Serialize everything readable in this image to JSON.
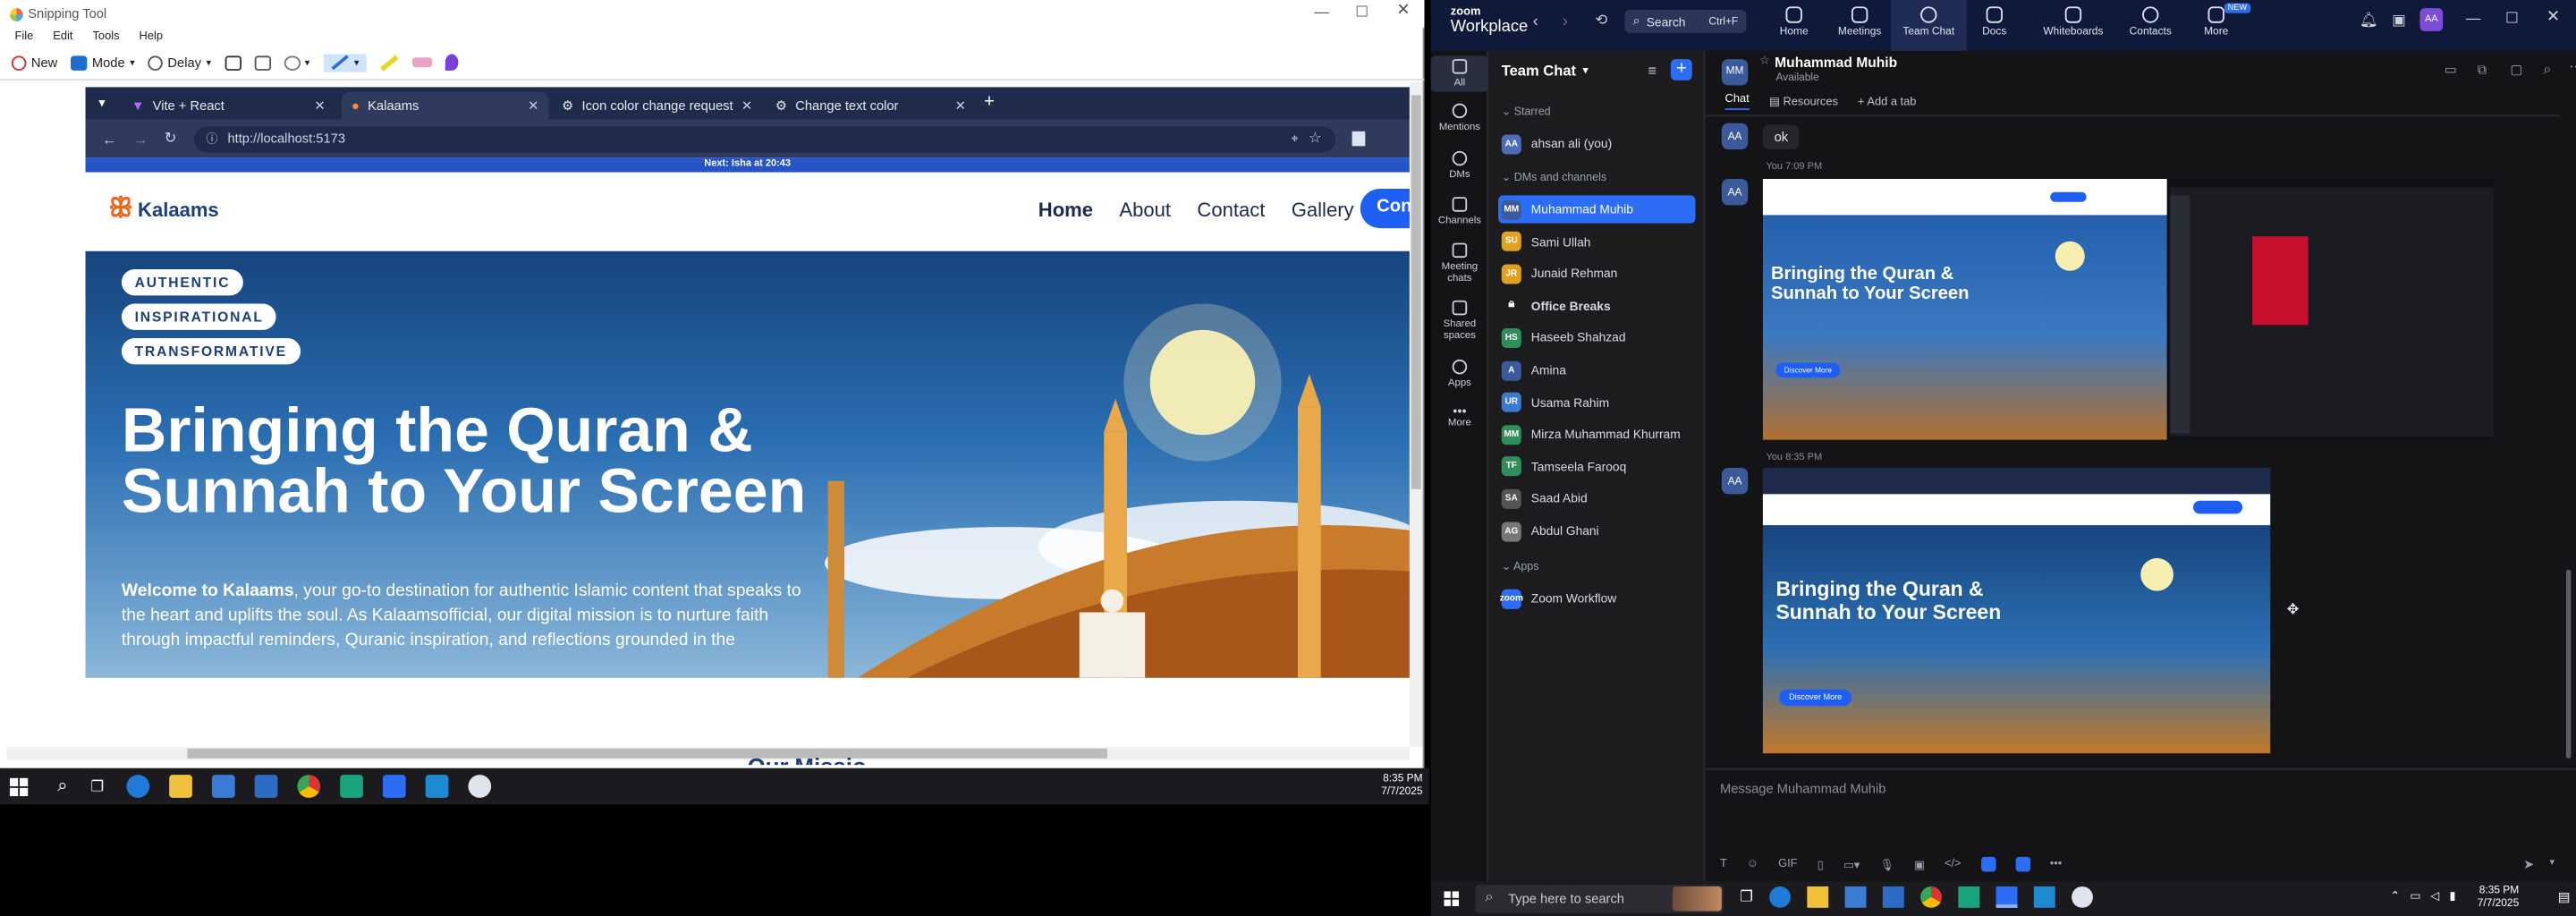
{
  "snip": {
    "title": "Snipping Tool",
    "menu": [
      "File",
      "Edit",
      "Tools",
      "Help"
    ],
    "new_label": "New",
    "mode_label": "Mode",
    "delay_label": "Delay"
  },
  "browser": {
    "tabs": [
      {
        "label": "Vite + React"
      },
      {
        "label": "Kalaams"
      },
      {
        "label": "Icon color change request"
      },
      {
        "label": "Change text color"
      }
    ],
    "url": "http://localhost:5173",
    "next_prayer": "Next: Isha at 20:43"
  },
  "site": {
    "brand": "Kalaams",
    "nav": [
      "Home",
      "About",
      "Contact",
      "Gallery"
    ],
    "cta": "Con",
    "badges": [
      "AUTHENTIC",
      "INSPIRATIONAL",
      "TRANSFORMATIVE"
    ],
    "headline": "Bringing the Quran & Sunnah to Your Screen",
    "para_a": "Welcome to Kalaams",
    "para_b": ", your go-to destination for authentic Islamic content that speaks to the heart and uplifts the soul. As Kalaamsofficial, our digital mission is to nurture faith through impactful reminders, Quranic inspiration, and reflections grounded in the",
    "partial": "Our Missio"
  },
  "left_taskbar": {
    "time": "8:35 PM",
    "date": "7/7/2025"
  },
  "zoom": {
    "brand_line1": "zoom",
    "brand_line2": "Workplace",
    "search": "Search",
    "search_shortcut": "Ctrl+F",
    "user_initials": "AA",
    "tabs": [
      "Home",
      "Meetings",
      "Team Chat",
      "Docs",
      "Whiteboards",
      "Contacts",
      "More"
    ],
    "new_badge": "NEW",
    "rail": [
      "All",
      "Mentions",
      "DMs",
      "Channels",
      "Meeting chats",
      "Shared spaces",
      "Apps",
      "More"
    ],
    "list_title": "Team Chat",
    "sections": {
      "starred": "Starred",
      "dms": "DMs and channels",
      "apps": "Apps"
    },
    "starred": [
      {
        "initials": "AA",
        "name": "ahsan ali (you)",
        "color": "#4b6cb7"
      }
    ],
    "contacts": [
      {
        "initials": "MM",
        "name": "Muhammad Muhib",
        "color": "#3a5a9c",
        "selected": true
      },
      {
        "initials": "SU",
        "name": "Sami Ullah",
        "color": "#e0a020"
      },
      {
        "initials": "JR",
        "name": "Junaid Rehman",
        "color": "#e0a020"
      },
      {
        "initials": "",
        "name": "Office Breaks",
        "color": "#444"
      },
      {
        "initials": "HS",
        "name": "Haseeb Shahzad",
        "color": "#2f8f5b"
      },
      {
        "initials": "A",
        "name": "Amina",
        "color": "#3a5a9c"
      },
      {
        "initials": "UR",
        "name": "Usama Rahim",
        "color": "#3a7ad0"
      },
      {
        "initials": "MM",
        "name": "Mirza Muhammad Khurram",
        "color": "#2f8f5b"
      },
      {
        "initials": "TF",
        "name": "Tamseela Farooq",
        "color": "#2f8f5b"
      },
      {
        "initials": "SA",
        "name": "Saad Abid",
        "color": "#555"
      },
      {
        "initials": "AG",
        "name": "Abdul Ghani",
        "color": "#777"
      }
    ],
    "apps": [
      {
        "initials": "zoom",
        "name": "Zoom Workflow",
        "color": "#2d6df6"
      }
    ],
    "chat": {
      "name": "Muhammad Muhib",
      "status": "Available",
      "initials": "MM",
      "tab_chat": "Chat",
      "tab_resources": "Resources",
      "add_tab": "Add a tab",
      "msg_ok": "ok",
      "ts1": "You 7:09 PM",
      "ts2": "You 8:35 PM",
      "thumb_headline": "Bringing the Quran & Sunnah to Your Screen",
      "thumb_button": "Discover More",
      "composer_placeholder": "Message Muhammad Muhib"
    }
  },
  "right_taskbar": {
    "search_placeholder": "Type here to search",
    "time": "8:35 PM",
    "date": "7/7/2025"
  }
}
